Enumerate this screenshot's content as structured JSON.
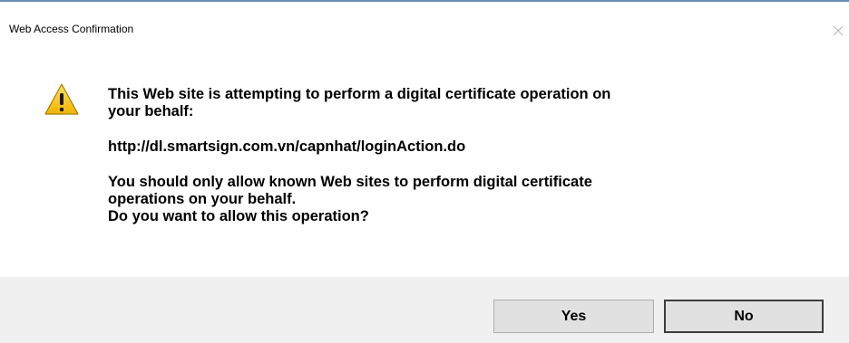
{
  "window": {
    "title": "Web Access Confirmation"
  },
  "icons": {
    "warning": "warning-icon",
    "close": "close-icon"
  },
  "message": {
    "line1": "This Web site is attempting to perform a digital certificate operation on",
    "line2": "your behalf:",
    "url": "http://dl.smartsign.com.vn/capnhat/loginAction.do",
    "line3": "You should only allow known Web sites to perform digital certificate",
    "line4": "operations on your behalf.",
    "line5": "Do you want to allow this operation?"
  },
  "buttons": {
    "yes": "Yes",
    "no": "No"
  },
  "colors": {
    "footer_bg": "#f0f0f0",
    "button_bg": "#e1e1e1",
    "warning_yellow": "#f5c400"
  }
}
